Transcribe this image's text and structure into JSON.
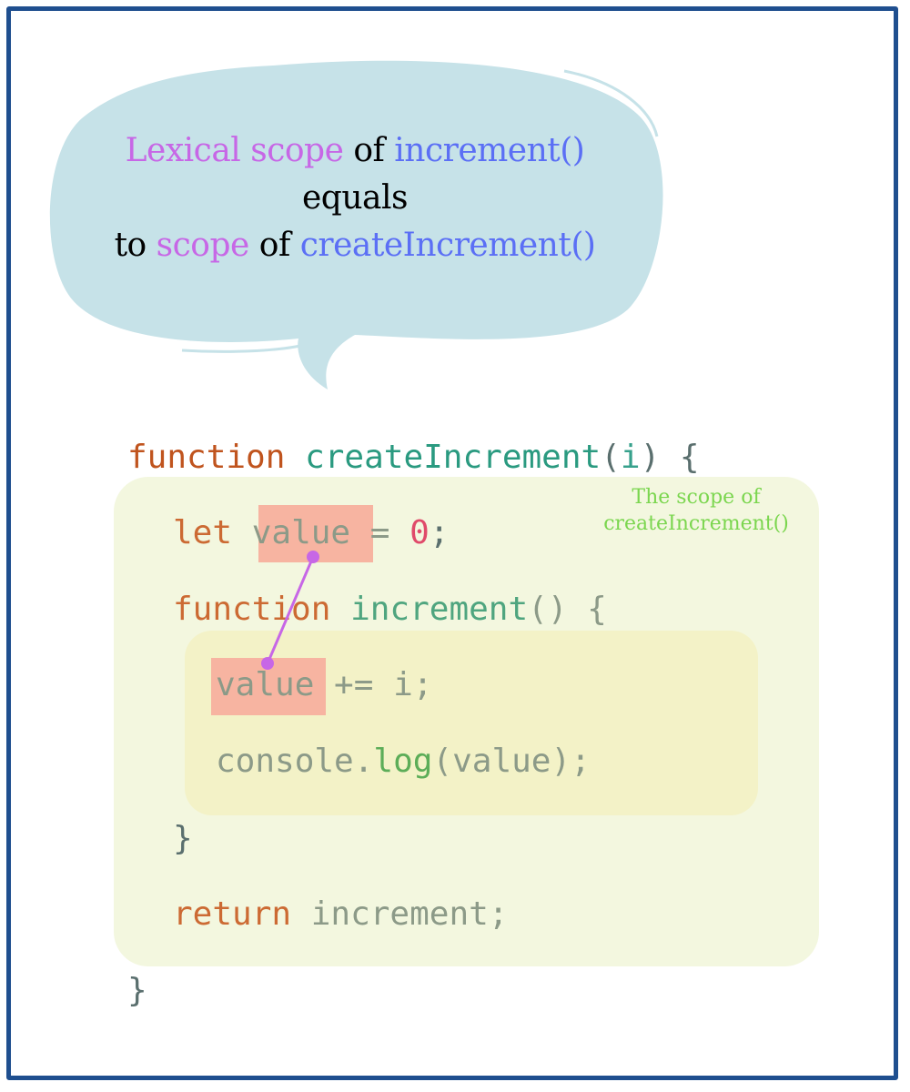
{
  "bubble": {
    "line1": {
      "part1": "Lexical scope",
      "part2": " of ",
      "part3": "increment()"
    },
    "line2": "equals",
    "line3": {
      "part1": "to ",
      "part2": "scope",
      "part3": " of ",
      "part4": "createIncrement()"
    }
  },
  "scope_label": {
    "line1": "The scope of",
    "line2": "createIncrement()"
  },
  "code": {
    "line1": {
      "kw": "function",
      "name": "createIncrement",
      "open": "(",
      "param": "i",
      "close": ") {"
    },
    "line2": {
      "kw": "let",
      "var": "value",
      "rest": " = ",
      "num": "0",
      "semi": ";"
    },
    "line3": {
      "kw": "function",
      "name": "increment",
      "rest": "() {"
    },
    "line4": {
      "var": "value",
      "rest": " += i;"
    },
    "line5": {
      "obj": "console.",
      "method": "log",
      "rest": "(value);"
    },
    "line6": {
      "brace": "}"
    },
    "line7": {
      "kw": "return",
      "rest": "increment;"
    },
    "line8": {
      "brace": "}"
    }
  },
  "colors": {
    "frame": "#1f4f8f",
    "bubble": "#c6e2e8",
    "scope_word": "#c767e6",
    "function_word": "#5b6ff5",
    "outer_scope": "#f3f7df",
    "inner_scope": "#f3f2c7",
    "highlight": "#f7b4a1",
    "link": "#c767e6",
    "scope_label": "#7bd64f"
  }
}
